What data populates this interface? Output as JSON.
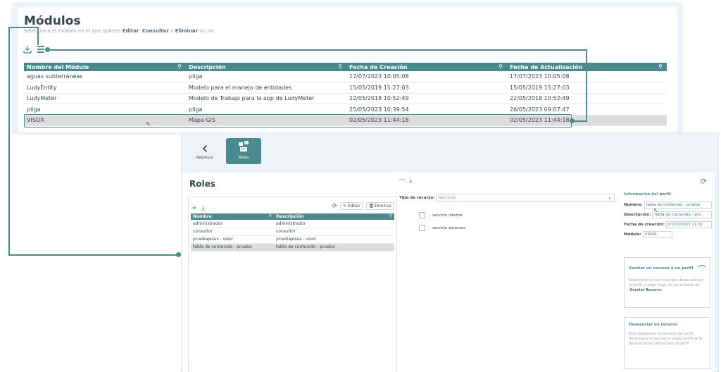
{
  "modulos": {
    "title": "Módulos",
    "subtitle_pre": "Selecciona el módulo en el que quieres ",
    "subtitle_editar": "Editar",
    "subtitle_sep1": ", ",
    "subtitle_consultar": "Consultar",
    "subtitle_sep2": " o ",
    "subtitle_eliminar": "Eliminar",
    "subtitle_post": " un rol",
    "icons": [
      "download-icon",
      "list-icon"
    ],
    "columns": [
      "Nombre del Módulo",
      "Descripción",
      "Fecha de Creación",
      "Fecha de Actualización"
    ],
    "rows": [
      [
        "aguas subterráneas",
        "pliga",
        "17/07/2023 10:05:08",
        "17/07/2023 10:05:08"
      ],
      [
        "LudyEntity",
        "Modelo para el manejo de entidades",
        "15/05/2019 15:27:03",
        "15/05/2019 15:27:03"
      ],
      [
        "LudyMeter",
        "Modelo de Trabajo para la app de LudyMeter",
        "22/05/2018 10:52:49",
        "22/05/2018 10:52:49"
      ],
      [
        "pliga",
        "pliga",
        "25/05/2023 10:39:54",
        "26/05/2023 09:07:47"
      ],
      [
        "VISOR",
        "Mapa GIS",
        "02/05/2023 11:44:18",
        "02/05/2023 11:44:18"
      ]
    ],
    "selected_row": 4
  },
  "nav": {
    "back_label": "Regresar",
    "roles_label": "Roles"
  },
  "roles": {
    "title": "Roles",
    "editar_label": "Editar",
    "eliminar_label": "Eliminar",
    "columns": [
      "Nombre",
      "Descripción"
    ],
    "rows": [
      [
        "administrador",
        "administrador"
      ],
      [
        "consultor",
        "consultor"
      ],
      [
        "pruebajesus - visor",
        "pruebajesus - visor"
      ],
      [
        "tabla de contenido - prueba",
        "tabla de contenido - prueba"
      ]
    ],
    "selected_row": 3
  },
  "recursos": {
    "tipo_label": "Tipo de recurso:",
    "tipo_value": "Servicios",
    "items": [
      "servicio interno",
      "servicio externos"
    ]
  },
  "perfil": {
    "title": "Información del perfil",
    "nombre_label": "Nombre:",
    "nombre_value": "tabla de contenido - prueba",
    "descripcion_label": "Descripción:",
    "descripcion_value": "tabla de contenido - pru",
    "fecha_label": "Fecha de creación:",
    "fecha_value": "07/07/2023 11:32",
    "modelo_label": "Modelo:",
    "modelo_value": "VISOR"
  },
  "asociar": {
    "title": "Asociar un recurso a un perfil",
    "desc_pre": "Seleccione los recursos que desea asociar al perfil y luego haga clic en el botón de '",
    "desc_bold": "Asociar Recurso",
    "desc_post": "'."
  },
  "desasociar": {
    "title": "Desasociar un recurso",
    "desc": "Para desasociar un recurso del perfil desmarque el recurso y luego confirme la desasociación del recurso al perfil."
  },
  "colors": {
    "accent": "#4a8a8c",
    "text": "#37474f",
    "selected_row": "#dcdcdc"
  }
}
